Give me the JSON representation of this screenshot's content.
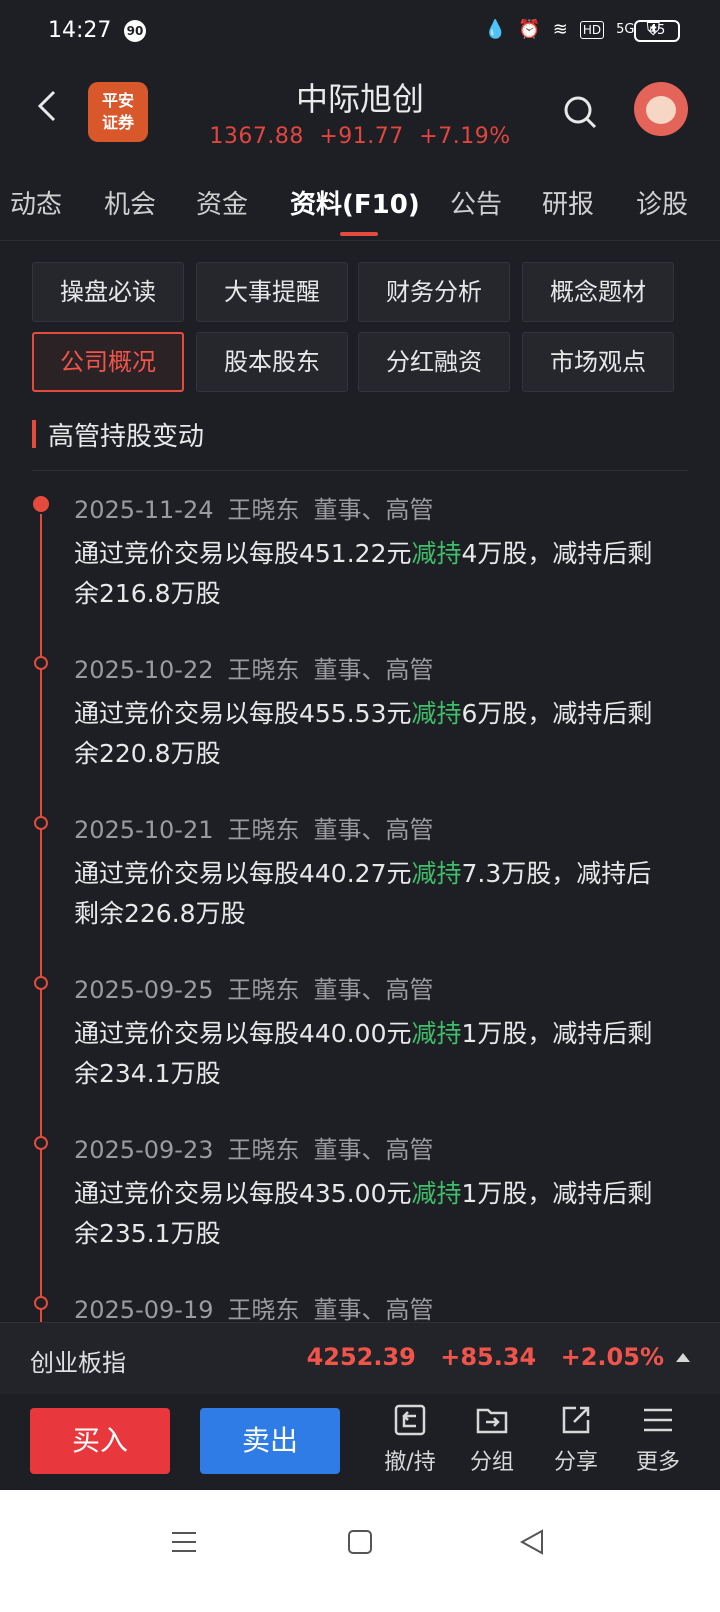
{
  "status": {
    "time": "14:27",
    "notification_count": "90",
    "battery": "45",
    "network": "5G",
    "hd": "HD"
  },
  "header": {
    "broker_logo": "平安\n证券",
    "title": "中际旭创",
    "price": "1367.88",
    "change": "+91.77",
    "change_pct": "+7.19%"
  },
  "tabs": [
    {
      "label": "动态"
    },
    {
      "label": "机会"
    },
    {
      "label": "资金"
    },
    {
      "label": "资料(F10)"
    },
    {
      "label": "公告"
    },
    {
      "label": "研报"
    },
    {
      "label": "诊股"
    }
  ],
  "grid_buttons": [
    {
      "label": "操盘必读"
    },
    {
      "label": "大事提醒"
    },
    {
      "label": "财务分析"
    },
    {
      "label": "概念题材"
    },
    {
      "label": "公司概况"
    },
    {
      "label": "股本股东"
    },
    {
      "label": "分红融资"
    },
    {
      "label": "市场观点"
    }
  ],
  "section_title": "高管持股变动",
  "entries": [
    {
      "date": "2025-11-24",
      "name": "王晓东",
      "role": "董事、高管",
      "pre": "通过竞价交易以每股451.22元",
      "action": "减持",
      "post": "4万股，减持后剩余216.8万股"
    },
    {
      "date": "2025-10-22",
      "name": "王晓东",
      "role": "董事、高管",
      "pre": "通过竞价交易以每股455.53元",
      "action": "减持",
      "post": "6万股，减持后剩余220.8万股"
    },
    {
      "date": "2025-10-21",
      "name": "王晓东",
      "role": "董事、高管",
      "pre": "通过竞价交易以每股440.27元",
      "action": "减持",
      "post": "7.3万股，减持后剩余226.8万股"
    },
    {
      "date": "2025-09-25",
      "name": "王晓东",
      "role": "董事、高管",
      "pre": "通过竞价交易以每股440.00元",
      "action": "减持",
      "post": "1万股，减持后剩余234.1万股"
    },
    {
      "date": "2025-09-23",
      "name": "王晓东",
      "role": "董事、高管",
      "pre": "通过竞价交易以每股435.00元",
      "action": "减持",
      "post": "1万股，减持后剩余235.1万股"
    },
    {
      "date": "2025-09-19",
      "name": "王晓东",
      "role": "董事、高管",
      "pre": "",
      "action": "",
      "post": ""
    }
  ],
  "index_bar": {
    "name": "创业板指",
    "value": "4252.39",
    "change": "+85.34",
    "change_pct": "+2.05%"
  },
  "actions": {
    "buy": "买入",
    "sell": "卖出",
    "cancel": "撤/持",
    "group": "分组",
    "share": "分享",
    "more": "更多"
  },
  "colors": {
    "up": "#e0463f",
    "sell_text": "#3fbf6a",
    "accent": "#e54b3d",
    "buy_bg": "#e8383d",
    "sell_bg": "#2f7ce6"
  },
  "icons": [
    "back-arrow-icon",
    "search-icon",
    "avatar-icon",
    "undo-icon",
    "folder-icon",
    "share-icon",
    "menu-icon"
  ]
}
